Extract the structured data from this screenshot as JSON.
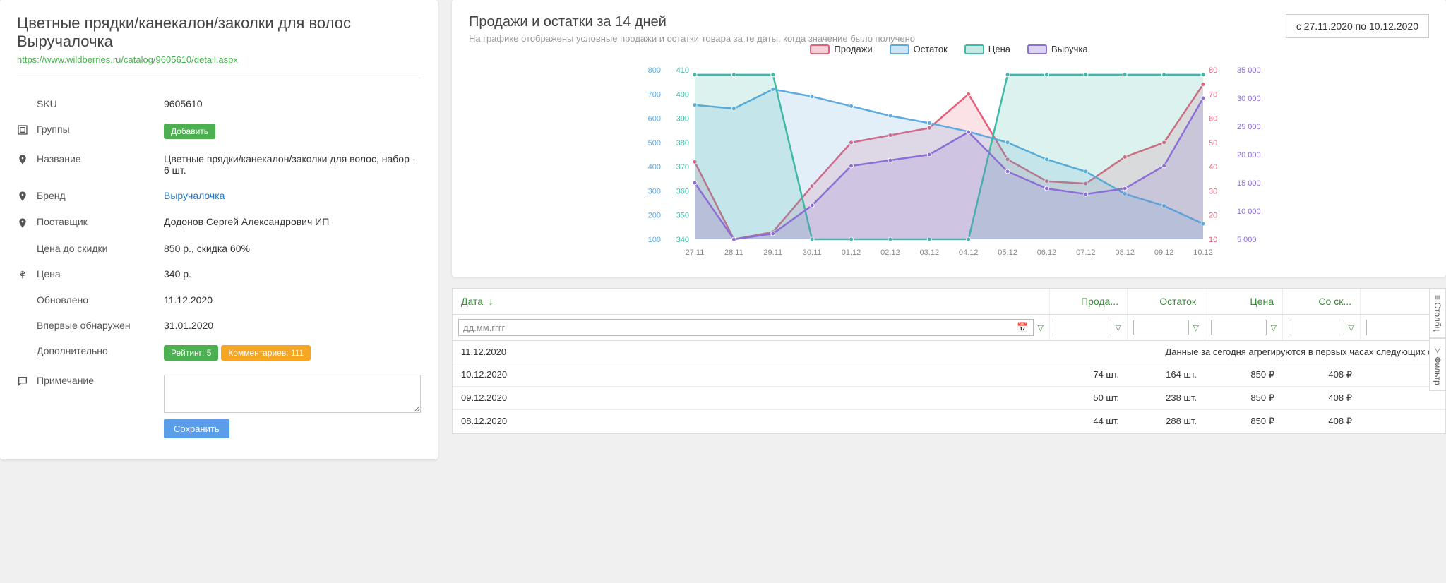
{
  "product": {
    "title": "Цветные прядки/канекалон/заколки для волос Выручалочка",
    "url": "https://www.wildberries.ru/catalog/9605610/detail.aspx",
    "fields": {
      "sku_label": "SKU",
      "sku_value": "9605610",
      "groups_label": "Группы",
      "groups_add": "Добавить",
      "name_label": "Название",
      "name_value": "Цветные прядки/канекалон/заколки для волос, набор - 6 шт.",
      "brand_label": "Бренд",
      "brand_value": "Выручалочка",
      "supplier_label": "Поставщик",
      "supplier_value": "Додонов Сергей Александрович ИП",
      "price_before_label": "Цена до скидки",
      "price_before_value": "850 р., скидка 60%",
      "price_label": "Цена",
      "price_value": "340 р.",
      "updated_label": "Обновлено",
      "updated_value": "11.12.2020",
      "first_seen_label": "Впервые обнаружен",
      "first_seen_value": "31.01.2020",
      "extra_label": "Дополнительно",
      "rating_badge": "Рейтинг: 5",
      "comments_badge": "Комментариев: 111",
      "note_label": "Примечание",
      "save_button": "Сохранить"
    }
  },
  "chart": {
    "title": "Продажи и остатки за 14 дней",
    "subtitle": "На графике отображены условные продажи и остатки товара за те даты, когда значение было получено",
    "date_range": "с 27.11.2020 по 10.12.2020",
    "legend": {
      "sales": "Продажи",
      "stock": "Остаток",
      "price": "Цена",
      "revenue": "Выручка"
    }
  },
  "chart_data": {
    "type": "line",
    "categories": [
      "27.11",
      "28.11",
      "29.11",
      "30.11",
      "01.12",
      "02.12",
      "03.12",
      "04.12",
      "05.12",
      "06.12",
      "07.12",
      "08.12",
      "09.12",
      "10.12"
    ],
    "series": [
      {
        "name": "Продажи",
        "color": "#e85e7a",
        "axis": "sales",
        "values": [
          42,
          10,
          13,
          32,
          50,
          53,
          56,
          70,
          43,
          34,
          33,
          44,
          50,
          74
        ]
      },
      {
        "name": "Остаток",
        "color": "#5ea9e0",
        "axis": "stock",
        "values": [
          655,
          640,
          720,
          690,
          650,
          610,
          580,
          545,
          500,
          430,
          380,
          288,
          238,
          164
        ]
      },
      {
        "name": "Цена",
        "color": "#3fb9a6",
        "axis": "price",
        "values": [
          408,
          408,
          408,
          340,
          340,
          340,
          340,
          340,
          408,
          408,
          408,
          408,
          408,
          408
        ]
      },
      {
        "name": "Выручка",
        "color": "#8b6fd6",
        "axis": "revenue",
        "values": [
          15000,
          5000,
          6000,
          11000,
          18000,
          19000,
          20000,
          24000,
          17000,
          14000,
          13000,
          14000,
          18000,
          30000
        ]
      }
    ],
    "axes": {
      "price": {
        "side": "left",
        "pos": 0,
        "range": [
          340,
          410
        ],
        "ticks": [
          340,
          350,
          360,
          370,
          380,
          390,
          400,
          410
        ],
        "color": "#3fb9a6"
      },
      "stock": {
        "side": "left",
        "pos": 40,
        "range": [
          100,
          800
        ],
        "ticks": [
          100,
          200,
          300,
          400,
          500,
          600,
          700,
          800
        ],
        "color": "#5ea9e0"
      },
      "sales": {
        "side": "right",
        "pos": 0,
        "range": [
          10,
          80
        ],
        "ticks": [
          10,
          20,
          30,
          40,
          50,
          60,
          70,
          80
        ],
        "color": "#e85e7a"
      },
      "revenue": {
        "side": "right",
        "pos": 40,
        "range": [
          5000,
          35000
        ],
        "ticks": [
          5000,
          10000,
          15000,
          20000,
          25000,
          30000,
          35000
        ],
        "color": "#8b6fd6",
        "fmt": "space"
      }
    }
  },
  "table": {
    "headers": {
      "date": "Дата",
      "sales": "Прода...",
      "stock": "Остаток",
      "price": "Цена",
      "discount": "Со ск..."
    },
    "date_placeholder": "дд.мм.гггг",
    "today_msg": "Данные за сегодня агрегируются в первых часах следующих су",
    "rows": [
      {
        "date": "11.12.2020",
        "today": true
      },
      {
        "date": "10.12.2020",
        "sales": "74 шт.",
        "stock": "164 шт.",
        "price": "850 ₽",
        "discount": "408 ₽"
      },
      {
        "date": "09.12.2020",
        "sales": "50 шт.",
        "stock": "238 шт.",
        "price": "850 ₽",
        "discount": "408 ₽"
      },
      {
        "date": "08.12.2020",
        "sales": "44 шт.",
        "stock": "288 шт.",
        "price": "850 ₽",
        "discount": "408 ₽"
      }
    ],
    "side_tabs": {
      "columns": "Столбц",
      "filters": "Фильтр"
    }
  }
}
